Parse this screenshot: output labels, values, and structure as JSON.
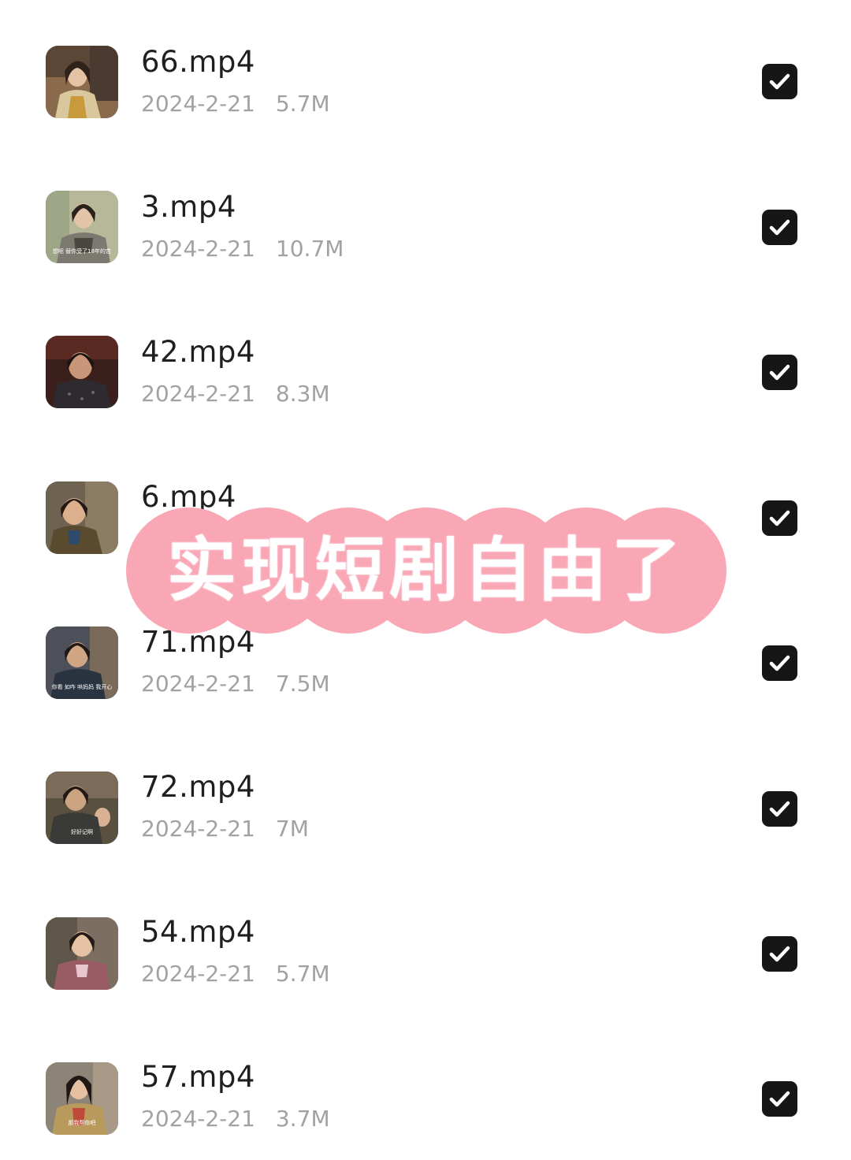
{
  "files": [
    {
      "name": "66.mp4",
      "date": "2024-2-21",
      "size": "5.7M",
      "checked": true,
      "thumb_caption": ""
    },
    {
      "name": "3.mp4",
      "date": "2024-2-21",
      "size": "10.7M",
      "checked": true,
      "thumb_caption": "想呢 替你受了18年的苦"
    },
    {
      "name": "42.mp4",
      "date": "2024-2-21",
      "size": "8.3M",
      "checked": true,
      "thumb_caption": ""
    },
    {
      "name": "6.mp4",
      "date": "",
      "size": "",
      "checked": true,
      "thumb_caption": ""
    },
    {
      "name": "71.mp4",
      "date": "2024-2-21",
      "size": "7.5M",
      "checked": true,
      "thumb_caption": "你看 如咋 哄妈妈 我开心"
    },
    {
      "name": "72.mp4",
      "date": "2024-2-21",
      "size": "7M",
      "checked": true,
      "thumb_caption": "好好记啊"
    },
    {
      "name": "54.mp4",
      "date": "2024-2-21",
      "size": "5.7M",
      "checked": true,
      "thumb_caption": ""
    },
    {
      "name": "57.mp4",
      "date": "2024-2-21",
      "size": "3.7M",
      "checked": true,
      "thumb_caption": "那我帮你吧"
    }
  ],
  "banner": {
    "text": "实现短剧自由了"
  },
  "colors": {
    "banner_pink": "#f9a6b5",
    "checkbox_fill": "#161616",
    "name_text": "#1f1f1f",
    "meta_text": "#a2a2a2"
  },
  "icons": {
    "checkbox": "checkmark-icon",
    "thumbnail": "video-thumbnail"
  }
}
